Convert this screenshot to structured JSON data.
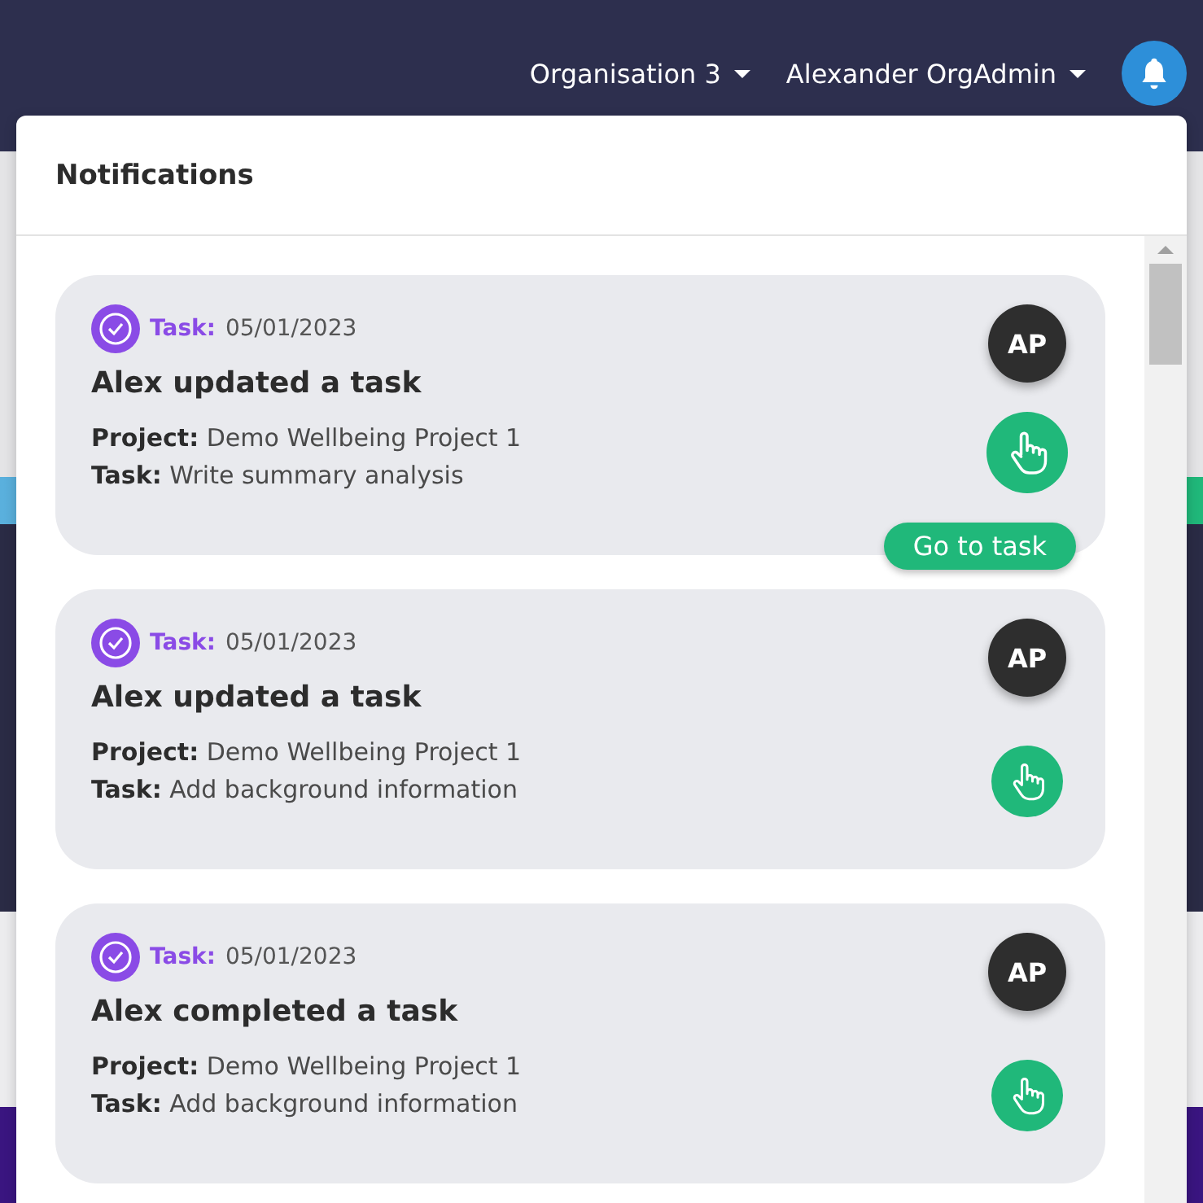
{
  "navbar": {
    "organisation": "Organisation 3",
    "user": "Alexander OrgAdmin"
  },
  "notifications": {
    "title": "Notifications",
    "items": [
      {
        "type_label": "Task:",
        "date": "05/01/2023",
        "title": "Alex updated a task",
        "project_label": "Project:",
        "project": "Demo Wellbeing Project 1",
        "task_label": "Task:",
        "task": "Write summary analysis",
        "avatar": "AP",
        "hovered": true,
        "tooltip": "Go to task"
      },
      {
        "type_label": "Task:",
        "date": "05/01/2023",
        "title": "Alex updated a task",
        "project_label": "Project:",
        "project": "Demo Wellbeing Project 1",
        "task_label": "Task:",
        "task": "Add background information",
        "avatar": "AP",
        "hovered": false
      },
      {
        "type_label": "Task:",
        "date": "05/01/2023",
        "title": "Alex completed a task",
        "project_label": "Project:",
        "project": "Demo Wellbeing Project 1",
        "task_label": "Task:",
        "task": "Add background information",
        "avatar": "AP",
        "hovered": false
      }
    ]
  }
}
